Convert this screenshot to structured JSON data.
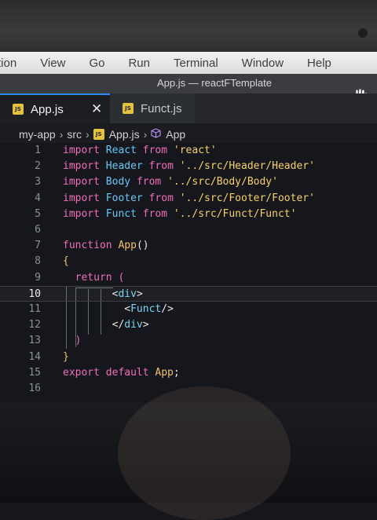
{
  "menubar": {
    "items": [
      "tion",
      "View",
      "Go",
      "Run",
      "Terminal",
      "Window",
      "Help"
    ]
  },
  "window": {
    "title": "App.js — reactFTemplate"
  },
  "tabs": [
    {
      "label": "App.js",
      "icon": "js-icon",
      "active": true
    },
    {
      "label": "Funct.js",
      "icon": "js-icon",
      "active": false
    }
  ],
  "breadcrumb": {
    "parts": [
      "my-app",
      "src",
      "App.js",
      "App"
    ]
  },
  "editor": {
    "current_line": 10,
    "lines": [
      {
        "n": "1",
        "tokens": [
          [
            "kw",
            "import "
          ],
          [
            "id",
            "React "
          ],
          [
            "kw",
            "from "
          ],
          [
            "str",
            "'react'"
          ]
        ]
      },
      {
        "n": "2",
        "tokens": [
          [
            "kw",
            "import "
          ],
          [
            "id",
            "Header "
          ],
          [
            "kw",
            "from "
          ],
          [
            "str",
            "'../src/Header/Header'"
          ]
        ]
      },
      {
        "n": "3",
        "tokens": [
          [
            "kw",
            "import "
          ],
          [
            "id",
            "Body "
          ],
          [
            "kw",
            "from "
          ],
          [
            "str",
            "'../src/Body/Body'"
          ]
        ]
      },
      {
        "n": "4",
        "tokens": [
          [
            "kw",
            "import "
          ],
          [
            "id",
            "Footer "
          ],
          [
            "kw",
            "from "
          ],
          [
            "str",
            "'../src/Footer/Footer'"
          ]
        ]
      },
      {
        "n": "5",
        "tokens": [
          [
            "kw",
            "import "
          ],
          [
            "id",
            "Funct "
          ],
          [
            "kw",
            "from "
          ],
          [
            "str",
            "'../src/Funct/Funct'"
          ]
        ]
      },
      {
        "n": "6",
        "tokens": []
      },
      {
        "n": "7",
        "tokens": [
          [
            "kw",
            "function "
          ],
          [
            "fn",
            "App"
          ],
          [
            "punc",
            "()"
          ]
        ]
      },
      {
        "n": "8",
        "tokens": [
          [
            "fn",
            "{"
          ]
        ]
      },
      {
        "n": "9",
        "tokens": [
          [
            "plain",
            "  "
          ],
          [
            "kw",
            "return "
          ],
          [
            "kw",
            "("
          ]
        ]
      },
      {
        "n": "10",
        "tokens": [
          [
            "plain",
            "        "
          ],
          [
            "punc",
            "<"
          ],
          [
            "tag",
            "div"
          ],
          [
            "punc",
            ">"
          ]
        ]
      },
      {
        "n": "11",
        "tokens": [
          [
            "plain",
            "          "
          ],
          [
            "punc",
            "<"
          ],
          [
            "tag",
            "Funct"
          ],
          [
            "punc",
            "/>"
          ]
        ]
      },
      {
        "n": "12",
        "tokens": [
          [
            "plain",
            "        "
          ],
          [
            "punc",
            "</"
          ],
          [
            "tag",
            "div"
          ],
          [
            "punc",
            ">"
          ]
        ]
      },
      {
        "n": "13",
        "tokens": [
          [
            "plain",
            "  "
          ],
          [
            "kw",
            ")"
          ]
        ]
      },
      {
        "n": "14",
        "tokens": [
          [
            "fn",
            "}"
          ]
        ]
      },
      {
        "n": "15",
        "tokens": [
          [
            "kw",
            "export default "
          ],
          [
            "fn",
            "App"
          ],
          [
            "plain",
            ";"
          ]
        ]
      },
      {
        "n": "16",
        "tokens": []
      }
    ]
  }
}
